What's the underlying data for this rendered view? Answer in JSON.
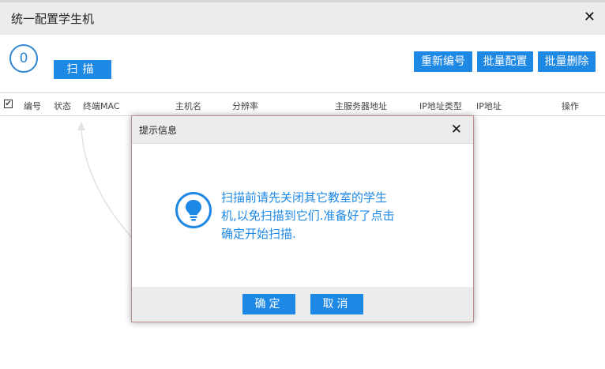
{
  "window": {
    "title": "统一配置学生机",
    "close_glyph": "✕"
  },
  "toolbar": {
    "count": "0",
    "scan_label": "扫描",
    "renumber_label": "重新编号",
    "batch_config_label": "批量配置",
    "batch_delete_label": "批量删除"
  },
  "table": {
    "checkbox_state": "✔",
    "columns": [
      "编号",
      "状态",
      "终端MAC",
      "主机名",
      "分辨率",
      "主服务器地址",
      "IP地址类型",
      "IP地址",
      "操作"
    ]
  },
  "dialog": {
    "title": "提示信息",
    "close_glyph": "✕",
    "icon": "lightbulb-icon",
    "message_lines": [
      "扫描前请先关闭其它教室的学生",
      "机,以免扫描到它们.准备好了点击",
      "确定开始扫描."
    ],
    "ok_label": "确定",
    "cancel_label": "取消"
  },
  "colors": {
    "accent": "#1e88e5",
    "annotation_arrow": "#e53935"
  }
}
